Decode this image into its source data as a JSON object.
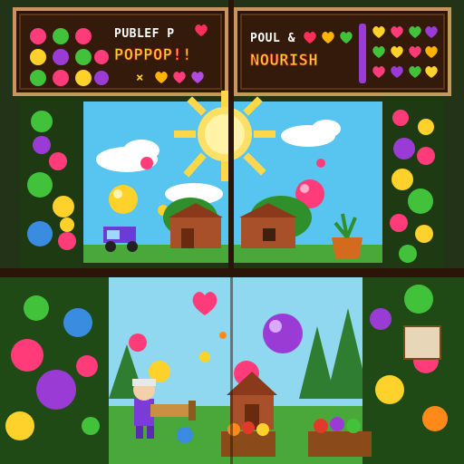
{
  "left_banner": {
    "line1": "PUBLEF P",
    "line2": "POPPOP!!",
    "line3": "×"
  },
  "right_banner": {
    "line1": "POUL &",
    "line2": "NOURISH"
  },
  "panel_labels": {
    "left_slot": "",
    "right_slot": ""
  },
  "colors": {
    "sky": "#58c4f0",
    "grass": "#4aa83a",
    "banner_bg": "#2b1508",
    "banner_frame": "#c8955a",
    "sun": "#ffd84a",
    "accent_pink": "#ff3b7a",
    "accent_purple": "#9b3bd6",
    "accent_yellow": "#ffd12b",
    "accent_green": "#42c23b"
  },
  "icons": {
    "heart": "heart-icon",
    "sun": "sun-icon",
    "tractor": "tractor-icon",
    "barn": "barn-icon",
    "crate": "fruit-crate-icon",
    "character": "farmer-character",
    "cannon": "bubble-cannon-icon"
  }
}
